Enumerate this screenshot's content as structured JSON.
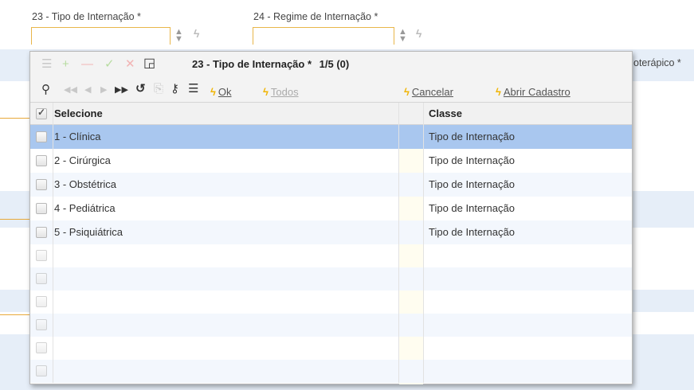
{
  "form": {
    "field23_label": "23 - Tipo de Internação *",
    "field24_label": "24 - Regime de Internação *",
    "cut_label": "oterápico *"
  },
  "popup": {
    "title": "23 - Tipo de Internação *",
    "count": "1/5 (0)",
    "buttons": {
      "ok": "Ok",
      "todos": "Todos",
      "cancelar": "Cancelar",
      "abrir_cadastro": "Abrir Cadastro"
    },
    "columns": {
      "selecione": "Selecione",
      "classe": "Classe"
    },
    "rows": [
      {
        "label": "1 - Clínica",
        "classe": "Tipo de Internação"
      },
      {
        "label": "2 - Cirúrgica",
        "classe": "Tipo de Internação"
      },
      {
        "label": "3 - Obstétrica",
        "classe": "Tipo de Internação"
      },
      {
        "label": "4 - Pediátrica",
        "classe": "Tipo de Internação"
      },
      {
        "label": "5 - Psiquiátrica",
        "classe": "Tipo de Internação"
      }
    ]
  },
  "icons": [
    "list-icon",
    "add-icon",
    "remove-icon",
    "confirm-icon",
    "cancel-icon",
    "popup-icon",
    "search-icon",
    "first-page-icon",
    "prev-page-icon",
    "next-page-icon",
    "last-page-icon",
    "refresh-icon",
    "export-icon",
    "key-icon",
    "columns-icon",
    "bolt-icon"
  ]
}
